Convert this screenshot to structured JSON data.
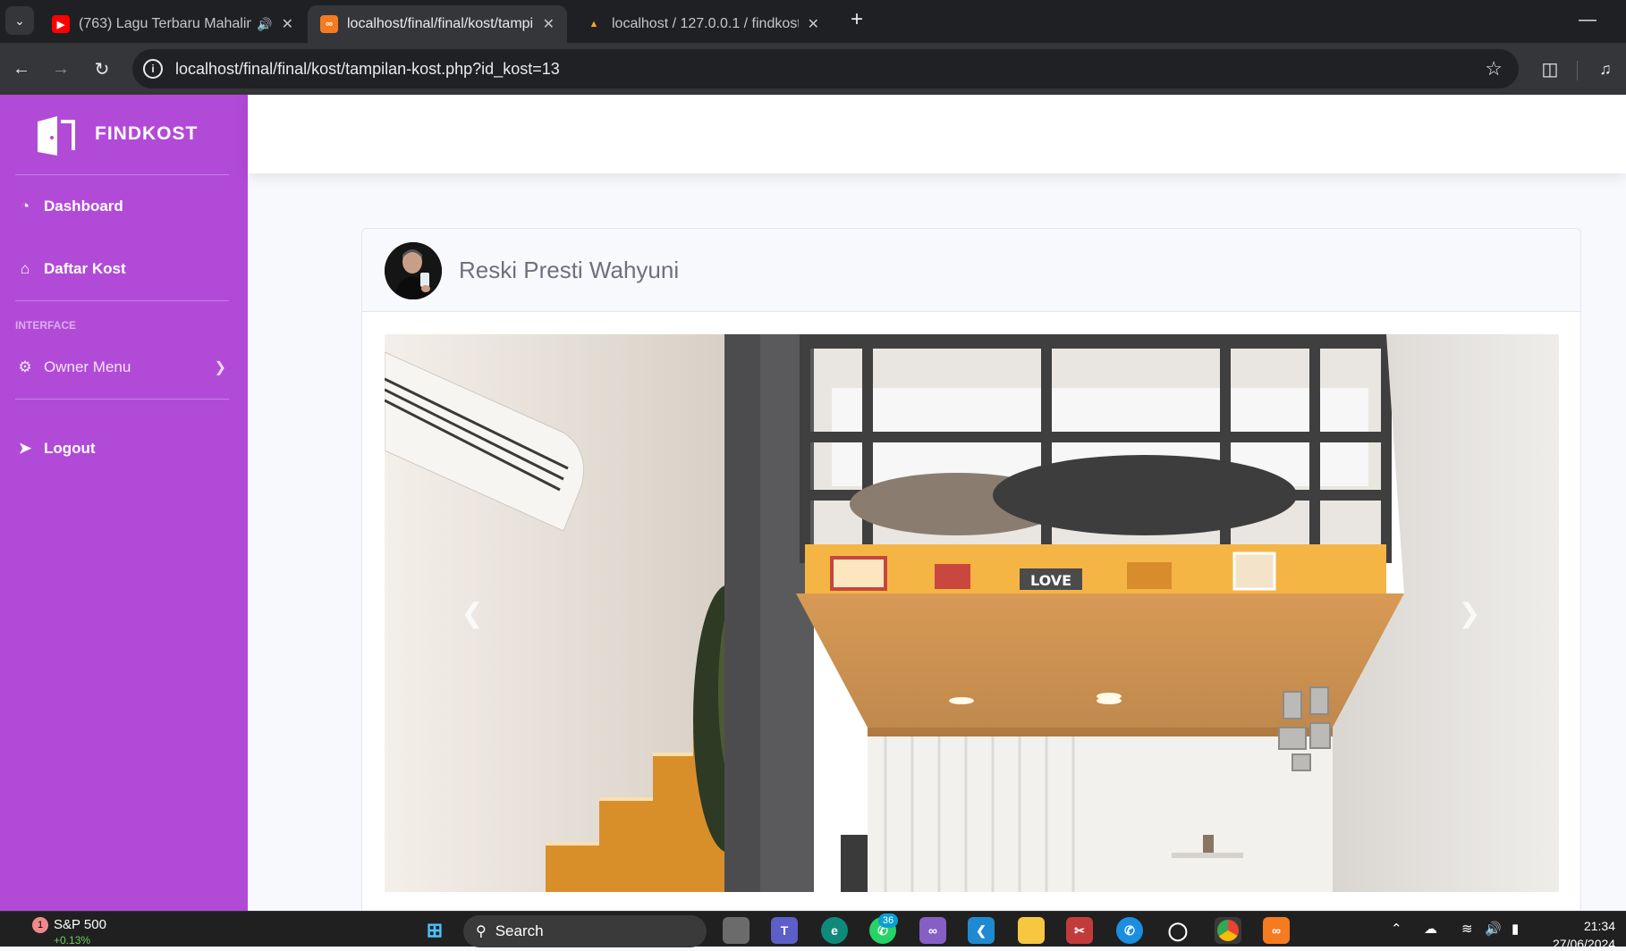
{
  "browser": {
    "tabs": [
      {
        "title": "(763) Lagu Terbaru Mahalini",
        "favicon_color": "#ff0000"
      },
      {
        "title": "localhost/final/final/kost/tampilan",
        "favicon_color": "#f57b20"
      },
      {
        "title": "localhost / 127.0.0.1 / findkostt",
        "favicon_color": "#f6a321"
      }
    ],
    "url": "localhost/final/final/kost/tampilan-kost.php?id_kost=13"
  },
  "sidebar": {
    "brand": "FINDKOST",
    "items": [
      {
        "label": "Dashboard",
        "icon": "dashboard-icon"
      },
      {
        "label": "Daftar Kost",
        "icon": "home-icon"
      }
    ],
    "section_heading": "INTERFACE",
    "owner_menu": "Owner Menu",
    "logout": "Logout",
    "color": "#b24ad8"
  },
  "card": {
    "owner_name": "Reski Presti Wahyuni",
    "image_text": "LOVE"
  },
  "taskbar": {
    "stock_name": "S&P 500",
    "stock_change": "+0.13%",
    "stock_badge": "1",
    "search_label": "Search",
    "whatsapp_badge": "36",
    "time": "21:34",
    "date": "27/06/2024"
  }
}
